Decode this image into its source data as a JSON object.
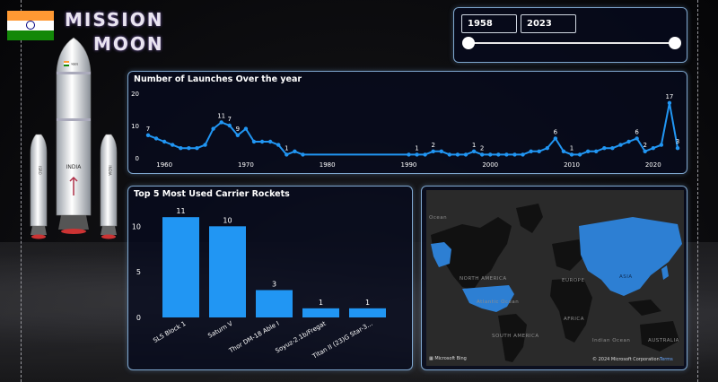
{
  "header": {
    "title_line1": "MISSION",
    "title_line2": "MOON"
  },
  "flag_colors": {
    "saffron": "#FF9933",
    "white": "#FFFFFF",
    "green": "#138808",
    "chakra": "#000080"
  },
  "rocket": {
    "flag_text": "भारत",
    "body_text": "INDIA",
    "booster_left_text": "ISRO",
    "booster_right_text": "INDIA"
  },
  "year_slider": {
    "start_year": "1958",
    "end_year": "2023",
    "start_fraction": 0,
    "end_fraction": 1
  },
  "launches_chart": {
    "title": "Number of Launches Over the year",
    "chart_data": {
      "type": "line",
      "x": [
        1958,
        1959,
        1960,
        1961,
        1962,
        1963,
        1964,
        1965,
        1966,
        1967,
        1968,
        1969,
        1970,
        1971,
        1972,
        1973,
        1974,
        1975,
        1976,
        1977,
        1990,
        1991,
        1992,
        1993,
        1994,
        1995,
        1996,
        1997,
        1998,
        1999,
        2000,
        2001,
        2002,
        2003,
        2004,
        2005,
        2006,
        2007,
        2008,
        2009,
        2010,
        2011,
        2012,
        2013,
        2014,
        2015,
        2016,
        2017,
        2018,
        2019,
        2020,
        2021,
        2022,
        2023
      ],
      "y": [
        7,
        6,
        5,
        4,
        3,
        3,
        3,
        4,
        9,
        11,
        10,
        7,
        9,
        5,
        5,
        5,
        4,
        1,
        2,
        1,
        1,
        1,
        1,
        2,
        2,
        1,
        1,
        1,
        2,
        1,
        1,
        1,
        1,
        1,
        1,
        2,
        2,
        3,
        6,
        2,
        1,
        1,
        2,
        2,
        3,
        3,
        4,
        5,
        6,
        2,
        3,
        4,
        17,
        3
      ],
      "point_labels": [
        {
          "x": 1958,
          "label": "7"
        },
        {
          "x": 1967,
          "label": "11"
        },
        {
          "x": 1968,
          "label": "7"
        },
        {
          "x": 1969,
          "label": "9"
        },
        {
          "x": 1975,
          "label": "1"
        },
        {
          "x": 1991,
          "label": "1"
        },
        {
          "x": 1993,
          "label": "2"
        },
        {
          "x": 1998,
          "label": "1"
        },
        {
          "x": 1999,
          "label": "2"
        },
        {
          "x": 2008,
          "label": "6"
        },
        {
          "x": 2010,
          "label": "1"
        },
        {
          "x": 2018,
          "label": "6"
        },
        {
          "x": 2019,
          "label": "2"
        },
        {
          "x": 2022,
          "label": "17"
        },
        {
          "x": 2023,
          "label": "3"
        }
      ],
      "xticks": [
        "1960",
        "1970",
        "1980",
        "1990",
        "2000",
        "2010",
        "2020"
      ],
      "xtick_values": [
        1960,
        1970,
        1980,
        1990,
        2000,
        2010,
        2020
      ],
      "yticks": [
        "0",
        "10",
        "20"
      ],
      "ytick_values": [
        0,
        10,
        20
      ],
      "xlim": [
        1958,
        2023
      ],
      "ylim": [
        0,
        20
      ],
      "color": "#2196F3",
      "grid": false
    }
  },
  "rockets_chart": {
    "title": "Top 5 Most Used Carrier Rockets",
    "chart_data": {
      "type": "bar",
      "categories": [
        "SLS Block 1",
        "Saturn V",
        "Thor DM-18 Able I",
        "Soyuz-2.1b/Fregat",
        "Titan II (23)G Star-3..."
      ],
      "values": [
        11,
        10,
        3,
        1,
        1
      ],
      "yticks": [
        "0",
        "5",
        "10"
      ],
      "ytick_values": [
        0,
        5,
        10
      ],
      "ylim": [
        0,
        12
      ],
      "color": "#2196F3",
      "grid": false
    }
  },
  "map": {
    "labels": {
      "north_america": "NORTH AMERICA",
      "south_america": "SOUTH AMERICA",
      "europe": "EUROPE",
      "africa": "AFRICA",
      "asia": "ASIA",
      "australia": "AUSTRALIA",
      "atlantic": "Atlantic Ocean",
      "indian": "Indian Ocean",
      "ocean_top": "Ocean"
    },
    "credit_bing": "Microsoft Bing",
    "credit_copyright": "© 2024 Microsoft Corporation",
    "credit_terms": "Terms",
    "highlight_color": "#2D7FD3",
    "land_color": "#111111",
    "water_color": "#2a2a2a"
  }
}
